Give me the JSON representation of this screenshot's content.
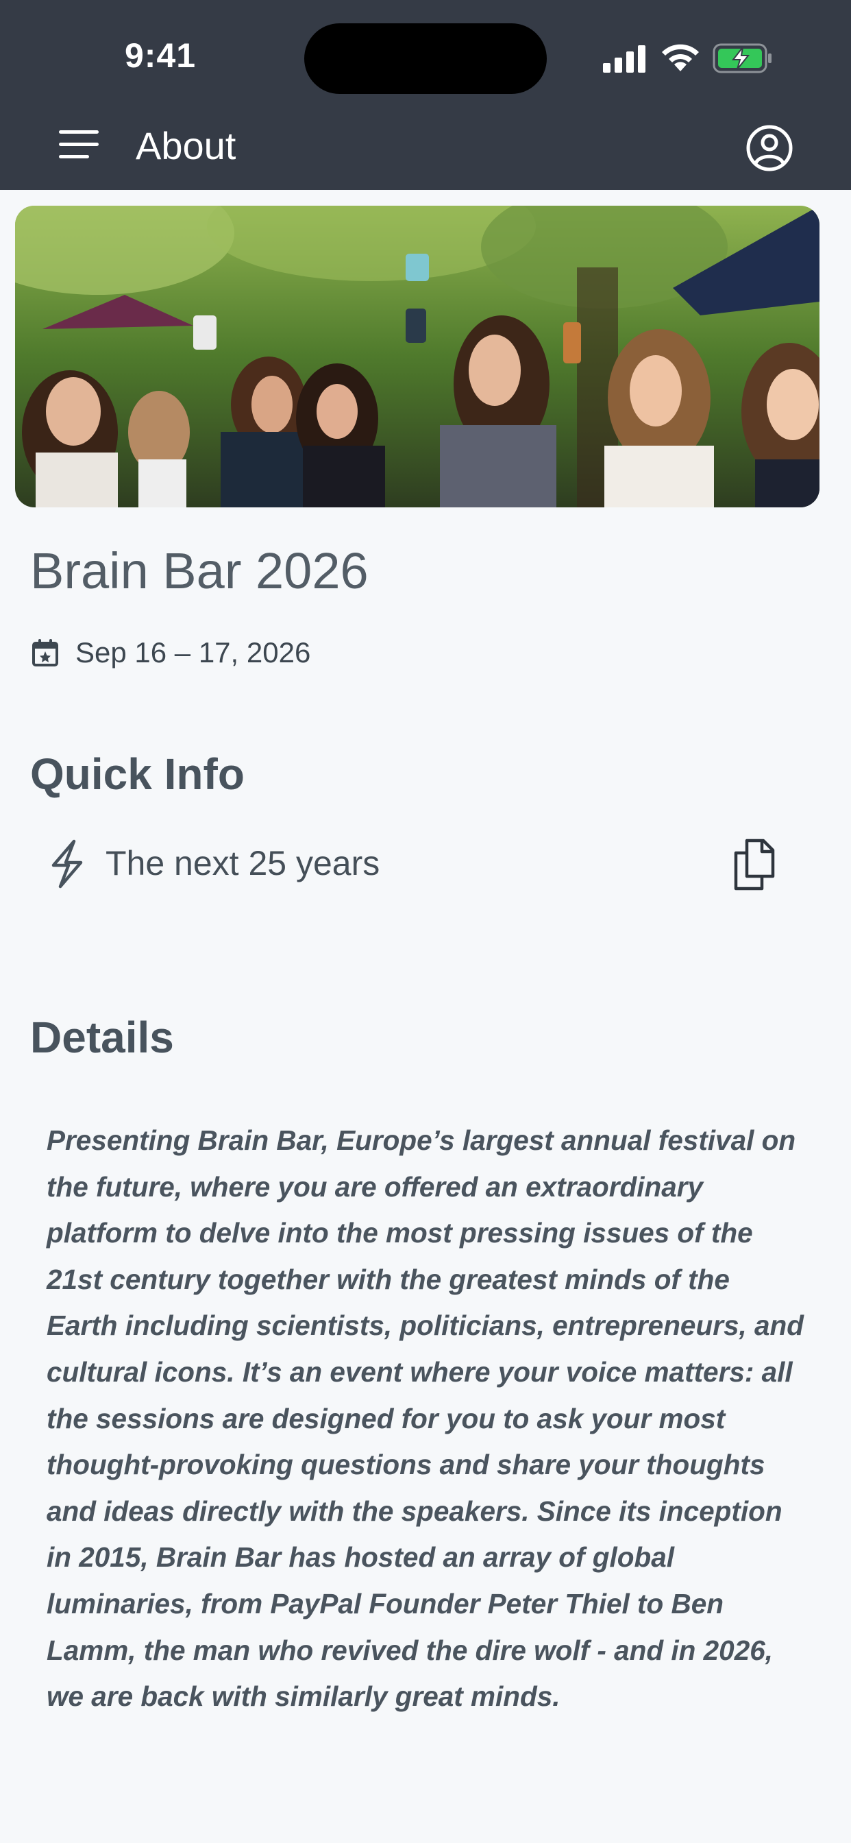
{
  "status_bar": {
    "time": "9:41",
    "icons": [
      "cellular-signal-icon",
      "wifi-icon",
      "battery-charging-icon"
    ]
  },
  "header": {
    "title": "About",
    "icons": [
      "hamburger-menu-icon",
      "profile-icon"
    ]
  },
  "colors": {
    "header_bg": "#353b46",
    "page_bg": "#f6f8fa",
    "text": "#48535d",
    "battery_green": "#34c759"
  },
  "event": {
    "title": "Brain Bar 2026",
    "date": "Sep 16 – 17, 2026",
    "date_icon": "calendar-icon"
  },
  "quick_info": {
    "heading": "Quick Info",
    "item_text": "The next 25 years",
    "item_icon": "lightning-icon",
    "action_icon": "copy-icon"
  },
  "details": {
    "heading": "Details",
    "body": "Presenting Brain Bar, Europe’s largest annual festival on the future, where you are offered an extraordinary platform to delve into the most pressing issues of the 21st century together with the greatest minds of the Earth including scientists, politicians, entrepreneurs, and cultural icons. It’s an event where your voice matters: all the sessions are designed for you to ask your most thought-provoking questions and share your thoughts and ideas directly with the speakers. Since its inception in 2015, Brain Bar has hosted an array of global luminaries, from PayPal Founder Peter Thiel to Ben Lamm, the man who revived the dire wolf - and in 2026, we are back with similarly great minds."
  }
}
